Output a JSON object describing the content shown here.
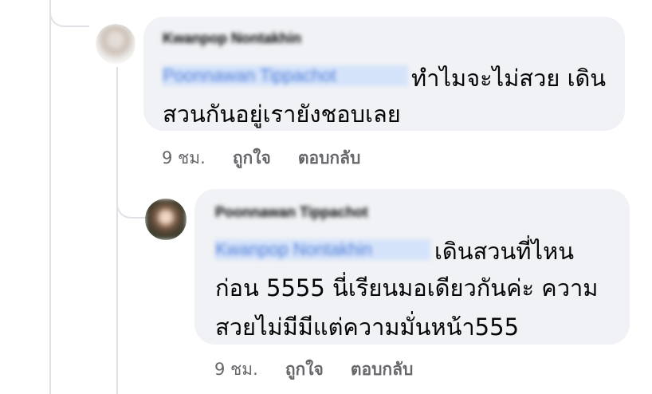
{
  "comments": [
    {
      "author": "Kwanpop Nontakhin",
      "mention": "Poonnawan Tippachot",
      "text_first": "ทำไมจะไม่สวย เดิน",
      "text_rest": "สวนกันอยู่เรายังชอบเลย",
      "time": "9 ชม.",
      "like_label": "ถูกใจ",
      "reply_label": "ตอบกลับ"
    },
    {
      "author": "Poonnawan Tippachot",
      "mention": "Kwanpop Nontakhin",
      "text_first": "เดินสวนที่ไหน",
      "text_rest": "ก่อน 5555 นี่เรียนมอเดียวกันค่ะ ความ\nสวยไม่มีมีแต่ความมั่นหน้า555",
      "time": "9 ชม.",
      "like_label": "ถูกใจ",
      "reply_label": "ตอบกลับ"
    }
  ],
  "colors": {
    "bubble": "#f0f2f5",
    "text": "#050505",
    "meta": "#65676b",
    "mention": "#4f7ed8",
    "thread_line": "#dfe1e5"
  },
  "icons": [
    "avatar-photo"
  ]
}
